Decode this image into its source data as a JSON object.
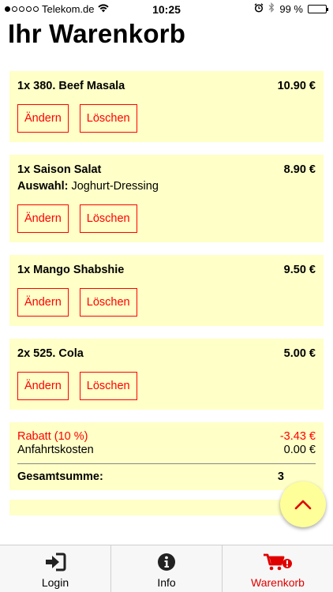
{
  "status_bar": {
    "carrier": "Telekom.de",
    "time": "10:25",
    "battery": "99 %",
    "battery_level": 0.99,
    "icons": [
      "signal-dots-icon",
      "wifi-icon",
      "alarm-icon",
      "bluetooth-icon",
      "battery-icon"
    ]
  },
  "page": {
    "title": "Ihr Warenkorb"
  },
  "cart": {
    "items": [
      {
        "name": "1x 380. Beef Masala",
        "price": "10.90 €",
        "edit_label": "Ändern",
        "delete_label": "Löschen"
      },
      {
        "name": "1x Saison Salat",
        "price": "8.90 €",
        "option_label": "Auswahl:",
        "option_value": " Joghurt-Dressing",
        "edit_label": "Ändern",
        "delete_label": "Löschen"
      },
      {
        "name": "1x Mango Shabshie",
        "price": "9.50 €",
        "edit_label": "Ändern",
        "delete_label": "Löschen"
      },
      {
        "name": "2x 525. Cola",
        "price": "5.00 €",
        "edit_label": "Ändern",
        "delete_label": "Löschen"
      }
    ]
  },
  "summary": {
    "discount_label": "Rabatt (10 %)",
    "discount_value": "-3.43 €",
    "delivery_label": "Anfahrtskosten",
    "delivery_value": "0.00 €",
    "total_label": "Gesamtsumme:",
    "total_value_visible": "3"
  },
  "scroll_top": {
    "icon": "chevron-up-icon"
  },
  "tabbar": {
    "tabs": [
      {
        "label": "Login",
        "icon": "login-icon",
        "active": false
      },
      {
        "label": "Info",
        "icon": "info-icon",
        "active": false
      },
      {
        "label": "Warenkorb",
        "icon": "cart-icon",
        "active": true
      }
    ]
  },
  "colors": {
    "accent": "#ff0000",
    "card": "#ffffc8",
    "fab": "#ffff99",
    "tab_active": "#e00000"
  }
}
